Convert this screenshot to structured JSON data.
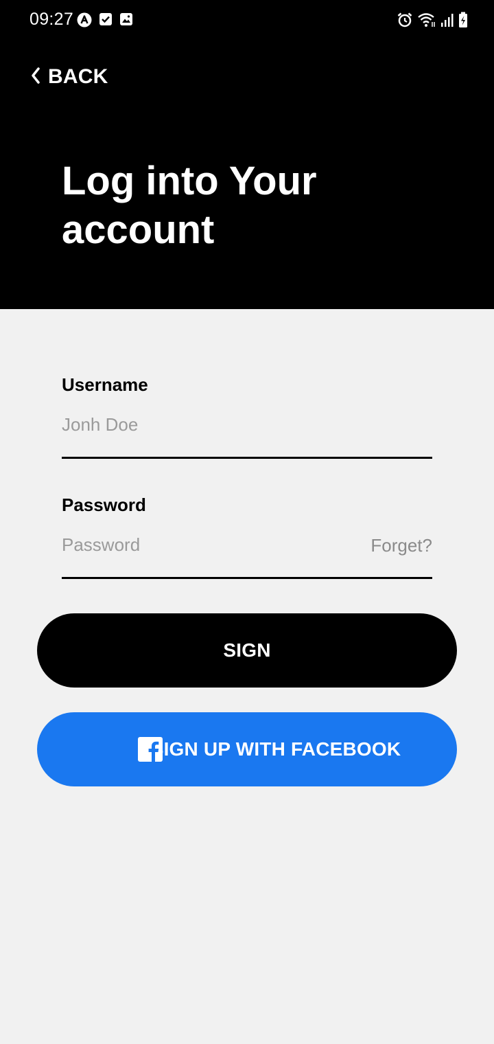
{
  "status_bar": {
    "time": "09:27",
    "left_icons": [
      "app-a-icon",
      "checkbox-icon",
      "image-icon"
    ],
    "right_icons": [
      "alarm-icon",
      "wifi-icon",
      "signal-icon",
      "battery-charging-icon"
    ]
  },
  "nav": {
    "back_label": "BACK"
  },
  "title": {
    "line1": "Log into Your",
    "line2": "account"
  },
  "form": {
    "username": {
      "label": "Username",
      "placeholder": "Jonh Doe"
    },
    "password": {
      "label": "Password",
      "placeholder": "Password",
      "forget_label": "Forget?"
    }
  },
  "buttons": {
    "sign_label": "SIGN",
    "facebook_label": "SIGN UP WITH FACEBOOK"
  },
  "colors": {
    "header_bg": "#000000",
    "body_bg": "#f1f1f1",
    "facebook_blue": "#1a78f0",
    "placeholder": "#9a9a9a"
  }
}
